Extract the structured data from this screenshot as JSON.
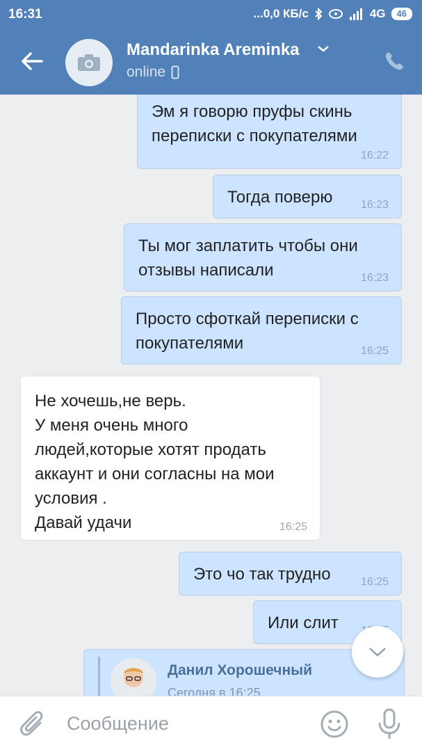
{
  "status_bar": {
    "time": "16:31",
    "network": "...0,0 КБ/с",
    "signal": "4G",
    "battery": "46"
  },
  "header": {
    "contact_name": "Mandarinka Areminka",
    "presence": "online"
  },
  "messages": [
    {
      "dir": "out",
      "text": "Эм я говорю пруфы скинь\nпереписки с покупателями",
      "time": "16:22"
    },
    {
      "dir": "out",
      "text": "Тогда поверю",
      "time": "16:23"
    },
    {
      "dir": "out",
      "text": "Ты мог заплатить чтобы они\nотзывы написали",
      "time": "16:23"
    },
    {
      "dir": "out",
      "text": "Просто сфоткай переписки с\nпокупателями",
      "time": "16:25"
    },
    {
      "dir": "in",
      "text": "Не хочешь,не верь.\nУ меня очень много\nлюдей,которые хотят продать\nаккаунт и они согласны на мои\nусловия .\nДавай удачи",
      "time": "16:25"
    },
    {
      "dir": "out",
      "text": "Это чо так трудно",
      "time": "16:25"
    },
    {
      "dir": "out",
      "text": "Или слит",
      "time": "16:25"
    }
  ],
  "forwarded": {
    "author": "Данил Хорошечный",
    "date": "Сегодня в 16:25"
  },
  "composer": {
    "placeholder": "Сообщение"
  },
  "colors": {
    "header": "#5181b8",
    "outgoing_bubble": "#cce4ff",
    "incoming_bubble": "#ffffff",
    "background": "#edeef0"
  }
}
